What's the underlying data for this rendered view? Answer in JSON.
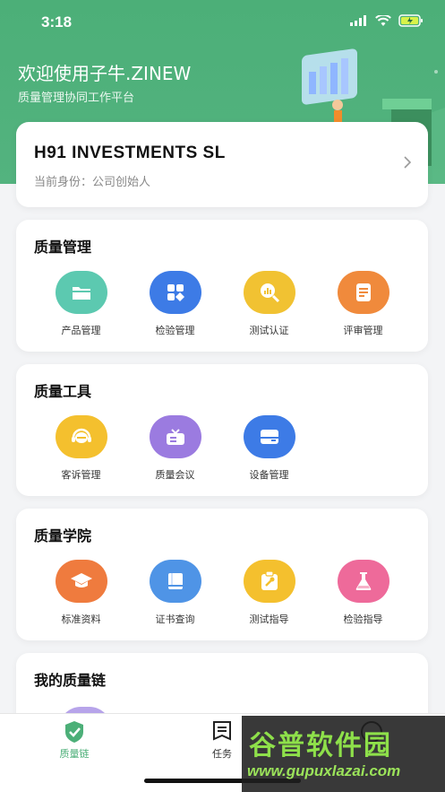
{
  "status_bar": {
    "time": "3:18"
  },
  "header": {
    "title": "欢迎使用子牛.ZINEW",
    "subtitle": "质量管理协同工作平台"
  },
  "company": {
    "name": "H91 INVESTMENTS SL",
    "role": "当前身份：公司创始人"
  },
  "sections": [
    {
      "title": "质量管理",
      "items": [
        {
          "label": "产品管理",
          "icon": "folder-icon",
          "color": "#5cc9b0"
        },
        {
          "label": "检验管理",
          "icon": "grid-icon",
          "color": "#3d7be6"
        },
        {
          "label": "测试认证",
          "icon": "chart-search-icon",
          "color": "#f1c232"
        },
        {
          "label": "评审管理",
          "icon": "document-icon",
          "color": "#f08a3c"
        }
      ]
    },
    {
      "title": "质量工具",
      "items": [
        {
          "label": "客诉管理",
          "icon": "headset-icon",
          "color": "#f4c02e"
        },
        {
          "label": "质量会议",
          "icon": "tv-icon",
          "color": "#9b7be0"
        },
        {
          "label": "设备管理",
          "icon": "device-icon",
          "color": "#3d7be6"
        }
      ]
    },
    {
      "title": "质量学院",
      "items": [
        {
          "label": "标准资料",
          "icon": "graduation-cap-icon",
          "color": "#ef7b3e"
        },
        {
          "label": "证书查询",
          "icon": "book-icon",
          "color": "#4f94e6"
        },
        {
          "label": "测试指导",
          "icon": "clipboard-wrench-icon",
          "color": "#f4c02e"
        },
        {
          "label": "检验指导",
          "icon": "flask-icon",
          "color": "#ee6a9a"
        }
      ]
    },
    {
      "title": "我的质量链",
      "items": []
    }
  ],
  "tabbar": {
    "items": [
      {
        "label": "质量链",
        "active": true,
        "icon": "shield-check-icon"
      },
      {
        "label": "任务",
        "active": false,
        "icon": "task-icon"
      },
      {
        "label": "",
        "active": false,
        "icon": "user-icon"
      }
    ],
    "active_color": "#4caf78"
  },
  "watermark": {
    "text": "谷普软件园",
    "url": "www.gupuxlazai.com"
  }
}
